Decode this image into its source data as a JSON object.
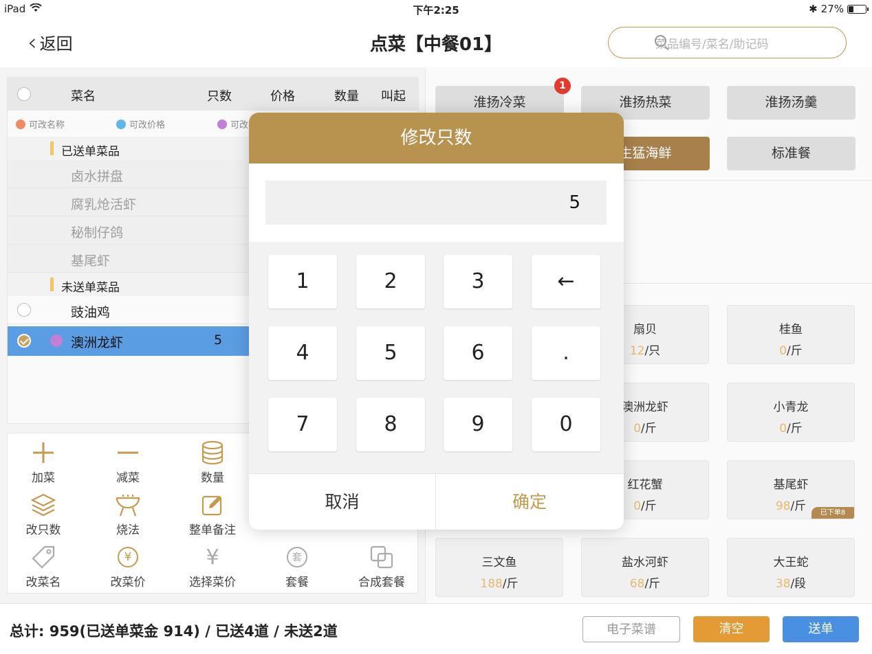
{
  "statusbar": {
    "device": "iPad",
    "time": "下午2:25",
    "battery": "27%"
  },
  "nav": {
    "back_label": "返回",
    "title": "点菜【中餐01】",
    "search_placeholder": "菜品编号/菜名/助记码"
  },
  "table": {
    "headers": {
      "name": "菜名",
      "count": "只数",
      "price": "价格",
      "qty": "数量",
      "call": "叫起"
    },
    "legend": {
      "edit_name": "可改名称",
      "edit_price": "可改价格",
      "edit_other": "可改"
    },
    "groups": {
      "sent": "已送单菜品",
      "unsent": "未送单菜品"
    },
    "sent_items": [
      "卤水拼盘",
      "腐乳炝活虾",
      "秘制仔鸽",
      "基尾虾"
    ],
    "unsent_items": [
      {
        "name": "豉油鸡",
        "count": ""
      },
      {
        "name": "澳洲龙虾",
        "count": "5"
      }
    ]
  },
  "actions": [
    {
      "label": "加菜",
      "icon": "plus-icon"
    },
    {
      "label": "减菜",
      "icon": "minus-icon"
    },
    {
      "label": "数量",
      "icon": "stack-icon"
    },
    {
      "label": "改只数",
      "icon": "layers-icon"
    },
    {
      "label": "烧法",
      "icon": "grill-icon"
    },
    {
      "label": "整单备注",
      "icon": "edit-icon"
    },
    {
      "label": "改菜名",
      "icon": "tag-icon"
    },
    {
      "label": "改菜价",
      "icon": "yuan-icon"
    },
    {
      "label": "选择菜价",
      "icon": "yuan-slash-icon"
    },
    {
      "label": "套餐",
      "icon": "set-icon"
    },
    {
      "label": "合成套餐",
      "icon": "merge-icon"
    }
  ],
  "categories": {
    "row1": [
      "淮扬冷菜",
      "淮扬热菜",
      "淮扬汤羹"
    ],
    "row2": [
      "生猛海鲜",
      "标准餐"
    ],
    "badge": "1"
  },
  "dishes": [
    {
      "name": "扇贝",
      "price": "12",
      "unit": "/只"
    },
    {
      "name": "桂鱼",
      "price": "0",
      "unit": "/斤"
    },
    {
      "name": "澳洲龙虾",
      "price": "0",
      "unit": "/斤"
    },
    {
      "name": "小青龙",
      "price": "0",
      "unit": "/斤"
    },
    {
      "name": "红花蟹",
      "price": "0",
      "unit": "/斤"
    },
    {
      "name": "基尾虾",
      "price": "98",
      "unit": "/斤",
      "tag": "已下单8"
    },
    {
      "name": "三文鱼",
      "price": "188",
      "unit": "/斤"
    },
    {
      "name": "盐水河虾",
      "price": "68",
      "unit": "/斤"
    },
    {
      "name": "大王蛇",
      "price": "38",
      "unit": "/段"
    }
  ],
  "footer": {
    "total": "总计: 959(已送单菜金 914) / 已送4道 / 未送2道",
    "menu_button": "电子菜谱",
    "clear_button": "清空",
    "send_button": "送单"
  },
  "dialog": {
    "title": "修改只数",
    "value": "5",
    "keys": [
      "1",
      "2",
      "3",
      "←",
      "4",
      "5",
      "6",
      ".",
      "7",
      "8",
      "9",
      "0"
    ],
    "cancel": "取消",
    "confirm": "确定"
  },
  "colors": {
    "accent": "#b8924f",
    "selected_row": "#5b9de3",
    "send": "#4a90e2",
    "clear": "#e49a35",
    "badge": "#e23a2f"
  }
}
